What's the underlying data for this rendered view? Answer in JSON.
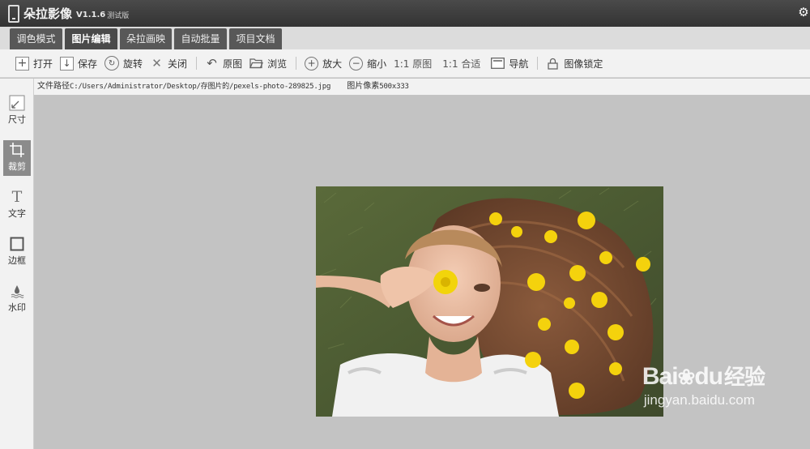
{
  "window": {
    "app_name": "朵拉影像",
    "version": "V1.1.6",
    "edition": "测试版"
  },
  "tabs": [
    {
      "label": "调色模式",
      "active": false
    },
    {
      "label": "图片编辑",
      "active": true
    },
    {
      "label": "朵拉画映",
      "active": false
    },
    {
      "label": "自动批量",
      "active": false
    },
    {
      "label": "项目文档",
      "active": false
    }
  ],
  "toolbar": {
    "open": "打开",
    "save": "保存",
    "rotate": "旋转",
    "close": "关闭",
    "original": "原图",
    "browse": "浏览",
    "zoom_in": "放大",
    "zoom_out": "缩小",
    "actual_size": "1:1 原图",
    "fit": "1:1 合适",
    "navigate": "导航",
    "lock": "图像锁定"
  },
  "file_info": {
    "path_label": "文件路径",
    "path": "C:/Users/Administrator/Desktop/存图片的/pexels-photo-289825.jpg",
    "pixels_label": "图片像素",
    "pixels": "500x333"
  },
  "sidebar": {
    "items": [
      {
        "label": "尺寸",
        "icon": "resize-icon"
      },
      {
        "label": "裁剪",
        "icon": "crop-icon",
        "active": true
      },
      {
        "label": "文字",
        "icon": "text-icon"
      },
      {
        "label": "边框",
        "icon": "border-icon"
      },
      {
        "label": "水印",
        "icon": "watermark-icon"
      }
    ]
  },
  "watermark": {
    "logo_latin": "Bai",
    "logo_du": "du",
    "logo_cn": "经验",
    "url": "jingyan.baidu.com"
  }
}
